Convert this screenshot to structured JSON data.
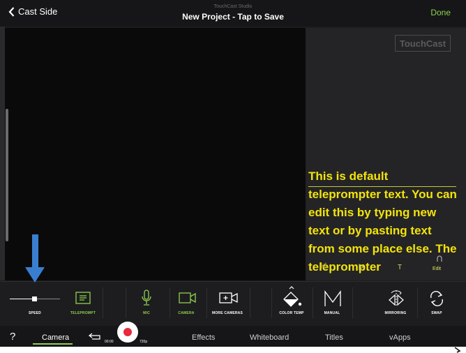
{
  "header": {
    "back_label": "Cast Side",
    "studio_label": "TouchCast Studio",
    "project_title": "New Project - Tap to Save",
    "done_label": "Done"
  },
  "preview": {
    "logo_text": "TouchCast",
    "teleprompter_text": "This is default teleprompter text. You can edit this by typing new text or by pasting text from some place else. The teleprompter",
    "controls": {
      "edit_label": "Edit",
      "text_icon": "T"
    }
  },
  "toolbar": {
    "speed_label": "SPEED",
    "speed_value": 0.5,
    "teleprompt_label": "TELEPROMPT",
    "mic_label": "MIC",
    "camera_label": "CAMERA",
    "more_cameras_label": "MORE CAMERAS",
    "color_temp_label": "COLOR TEMP",
    "manual_label": "MANUAL",
    "mirroring_label": "MIRRORING",
    "swap_label": "SWAP"
  },
  "bottom_bar": {
    "help_label": "?",
    "tabs": [
      {
        "label": "Camera",
        "active": true
      },
      {
        "label": "Effects"
      },
      {
        "label": "Whiteboard"
      },
      {
        "label": "Titles"
      },
      {
        "label": "vApps"
      }
    ],
    "timer": "00:00",
    "resolution": "720p"
  },
  "colors": {
    "accent_green": "#8fd14f",
    "teleprompter_yellow": "#f3e40a",
    "record_red": "#e8293e",
    "annotation_arrow": "#3a7fcf"
  },
  "icons": [
    "chevron-left-icon",
    "teleprompt-icon",
    "microphone-icon",
    "video-camera-icon",
    "add-camera-icon",
    "color-temp-icon",
    "manual-icon",
    "mirroring-icon",
    "swap-icon",
    "undo-icon",
    "record-icon",
    "skip-back-icon",
    "play-icon",
    "help-icon",
    "down-arrow-icon"
  ]
}
